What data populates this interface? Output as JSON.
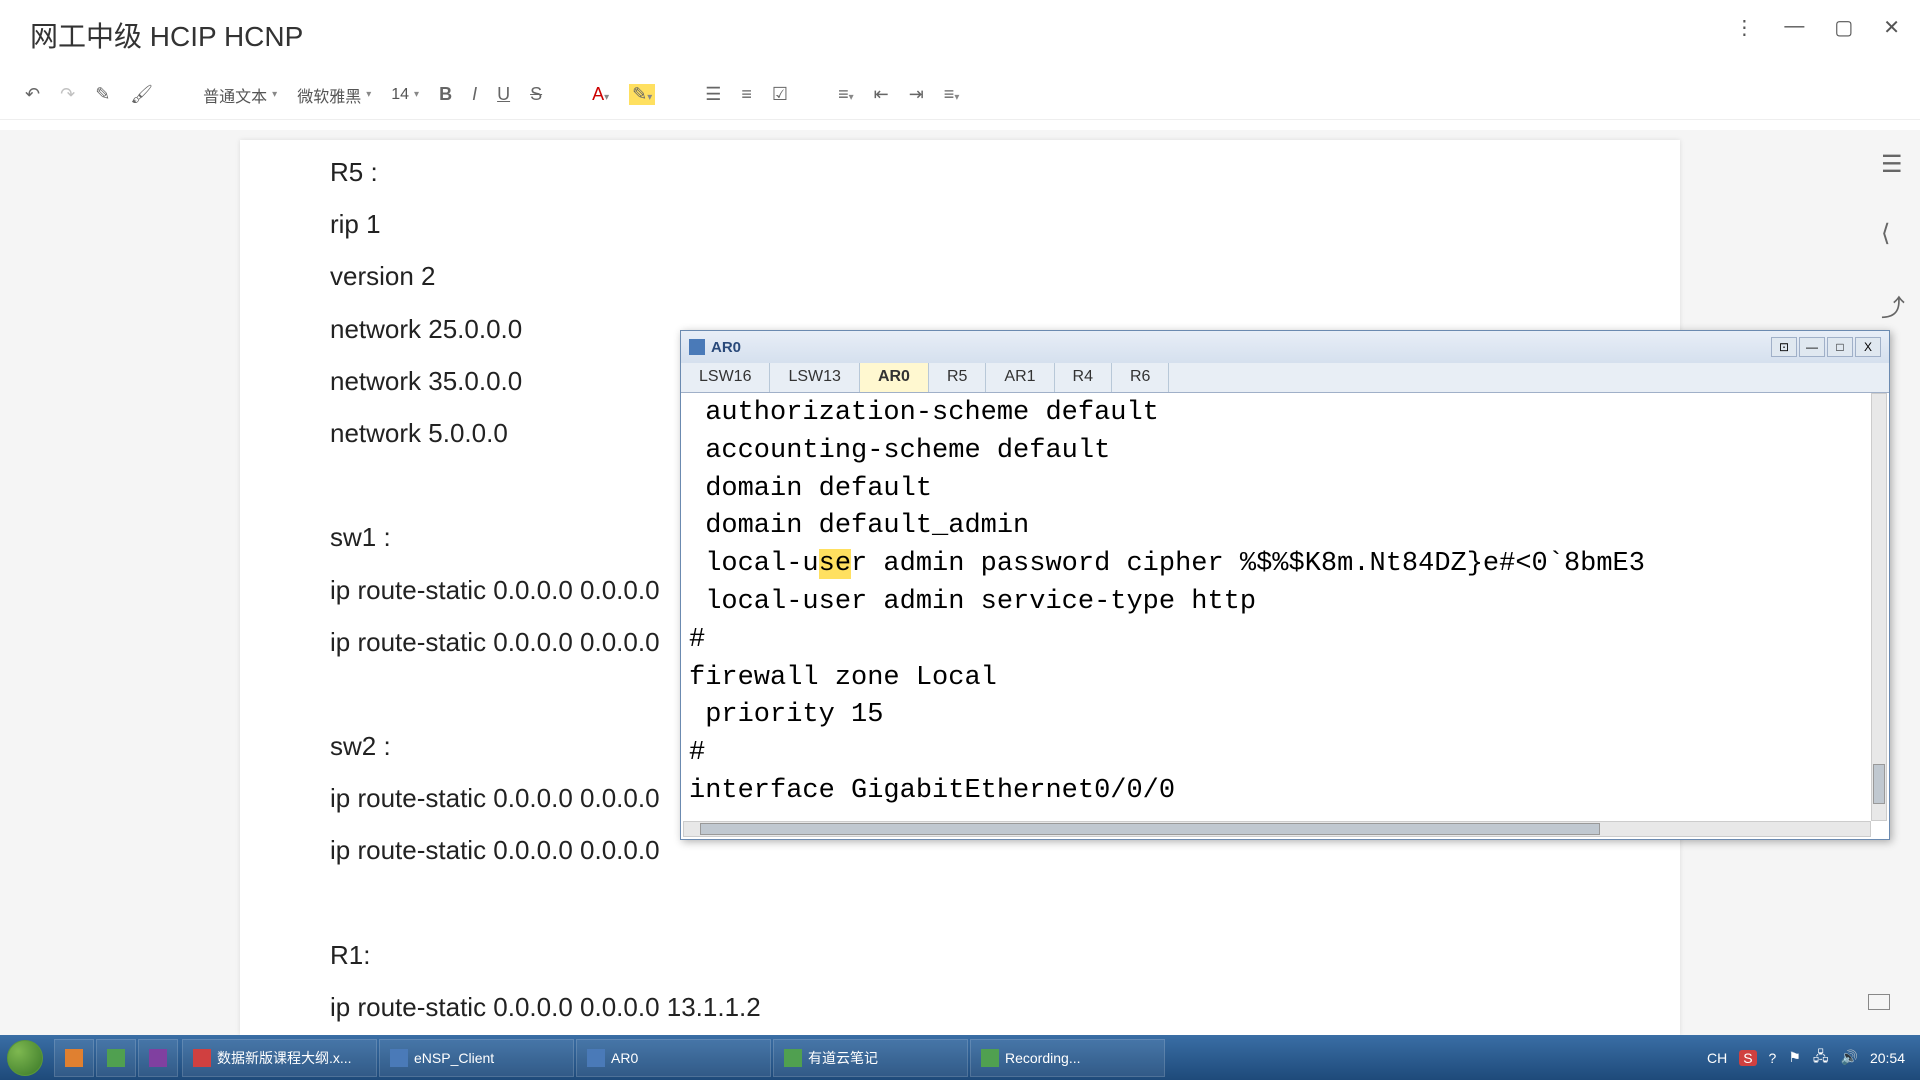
{
  "window": {
    "title": "网工中级 HCIP HCNP"
  },
  "toolbar": {
    "style_label": "普通文本",
    "font_label": "微软雅黑",
    "size_label": "14"
  },
  "document": {
    "lines": [
      "R5 :",
      "rip 1",
      " version 2",
      " network 25.0.0.0",
      " network 35.0.0.0",
      " network 5.0.0.0",
      "",
      "sw1 :",
      "ip route-static 0.0.0.0 0.0.0.0",
      "ip route-static 0.0.0.0 0.0.0.0",
      "",
      "sw2 :",
      "ip route-static 0.0.0.0 0.0.0.0",
      "ip route-static 0.0.0.0 0.0.0.0",
      "",
      "R1:",
      "ip route-static 0.0.0.0 0.0.0.0 13.1.1.2"
    ]
  },
  "terminal": {
    "title": "AR0",
    "tabs": [
      "LSW16",
      "LSW13",
      "AR0",
      "R5",
      "AR1",
      "R4",
      "R6"
    ],
    "active_tab": "AR0",
    "lines": [
      " authorization-scheme default",
      " accounting-scheme default",
      " domain default",
      " domain default_admin",
      " local-user admin password cipher %$%$K8m.Nt84DZ}e#<0`8bmE3",
      " local-user admin service-type http",
      "#",
      "firewall zone Local",
      " priority 15",
      "#",
      "interface GigabitEthernet0/0/0"
    ]
  },
  "taskbar": {
    "apps": [
      {
        "label": "数据新版课程大纲.x...",
        "iconClass": "red"
      },
      {
        "label": "eNSP_Client",
        "iconClass": "blue"
      },
      {
        "label": "AR0",
        "iconClass": "blue"
      },
      {
        "label": "有道云笔记",
        "iconClass": "green"
      },
      {
        "label": "Recording...",
        "iconClass": "green"
      }
    ],
    "time": "20:54"
  }
}
